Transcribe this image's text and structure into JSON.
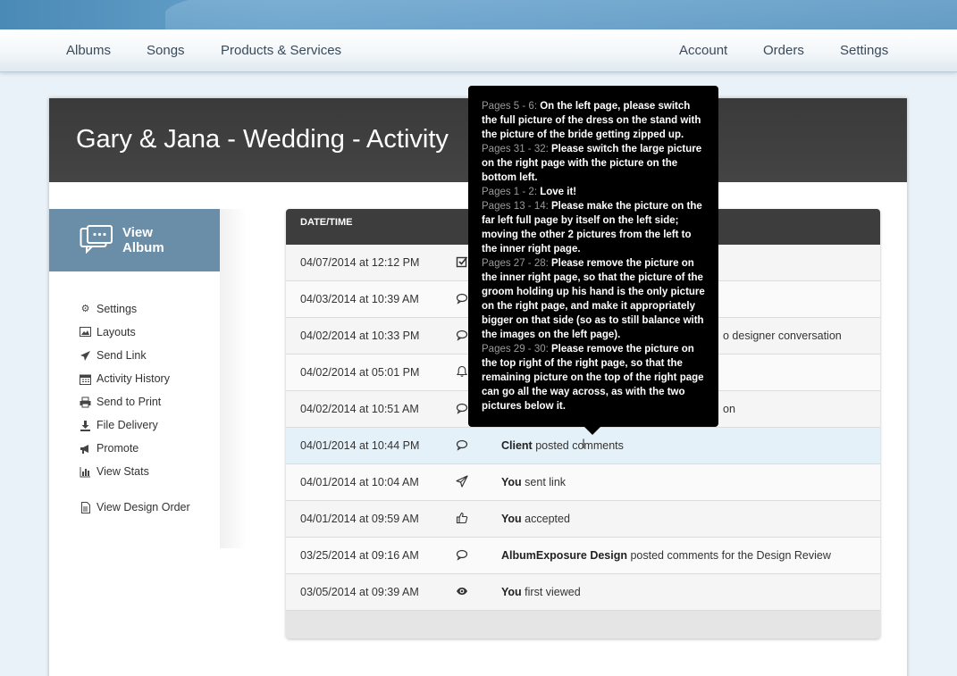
{
  "nav": {
    "left": [
      "Albums",
      "Songs",
      "Products & Services"
    ],
    "right": [
      "Account",
      "Orders",
      "Settings"
    ]
  },
  "page_title": "Gary & Jana - Wedding - Activity",
  "sidebar": {
    "view_album_label": "View Album",
    "items": [
      {
        "label": "Settings",
        "icon": "gear-icon"
      },
      {
        "label": "Layouts",
        "icon": "image-icon"
      },
      {
        "label": "Send Link",
        "icon": "paper-plane-icon"
      },
      {
        "label": "Activity History",
        "icon": "calendar-icon"
      },
      {
        "label": "Send to Print",
        "icon": "printer-icon"
      },
      {
        "label": "File Delivery",
        "icon": "download-icon"
      },
      {
        "label": "Promote",
        "icon": "megaphone-icon"
      },
      {
        "label": "View Stats",
        "icon": "bar-chart-icon"
      }
    ],
    "design_order": {
      "label": "View Design Order",
      "icon": "document-icon"
    }
  },
  "table": {
    "header_date": "DATE/TIME",
    "rows": [
      {
        "date": "04/07/2014 at 12:12 PM",
        "icon": "checkbox-icon",
        "actor": "",
        "text": ""
      },
      {
        "date": "04/03/2014 at 10:39 AM",
        "icon": "comment-icon",
        "actor": "",
        "text": ""
      },
      {
        "date": "04/02/2014 at 10:33 PM",
        "icon": "comment-icon",
        "actor": "",
        "text": "o designer conversation"
      },
      {
        "date": "04/02/2014 at 05:01 PM",
        "icon": "bell-icon",
        "actor": "",
        "text": ""
      },
      {
        "date": "04/02/2014 at 10:51 AM",
        "icon": "comment-icon",
        "actor": "",
        "text": "on"
      },
      {
        "date": "04/01/2014 at 10:44 PM",
        "icon": "comment-icon",
        "actor": "Client",
        "text": " posted comments"
      },
      {
        "date": "04/01/2014 at 10:04 AM",
        "icon": "paper-plane-icon",
        "actor": "You",
        "text": " sent link"
      },
      {
        "date": "04/01/2014 at 09:59 AM",
        "icon": "thumbs-up-icon",
        "actor": "You",
        "text": " accepted"
      },
      {
        "date": "03/25/2014 at 09:16 AM",
        "icon": "comment-icon",
        "actor": "AlbumExposure Design",
        "text": " posted comments for the Design Review"
      },
      {
        "date": "03/05/2014 at 09:39 AM",
        "icon": "eye-icon",
        "actor": "You",
        "text": " first viewed"
      }
    ]
  },
  "tooltip": {
    "comments": [
      {
        "pages": "Pages 5 - 6:",
        "text": " On the left page, please switch the full picture of the dress on the stand with the picture of the bride getting zipped up."
      },
      {
        "pages": "Pages 31 - 32:",
        "text": " Please switch the large picture on the right page with the picture on the bottom left."
      },
      {
        "pages": "Pages 1 - 2:",
        "text": " Love it!"
      },
      {
        "pages": "Pages 13 - 14:",
        "text": " Please make the picture on the far left full page by itself on the left side; moving the other 2 pictures from the left to the inner right page."
      },
      {
        "pages": "Pages 27 - 28:",
        "text": " Please remove the picture on the inner right page, so that the picture of the groom holding up his hand is the only picture on the right page, and make it appropriately bigger on that side (so as to still balance with the images on the left page)."
      },
      {
        "pages": "Pages 29 - 30:",
        "text": " Please remove the picture on the top right of the right page, so that the remaining picture on the top of the right page can go all the way across, as with the two pictures below it."
      }
    ]
  }
}
